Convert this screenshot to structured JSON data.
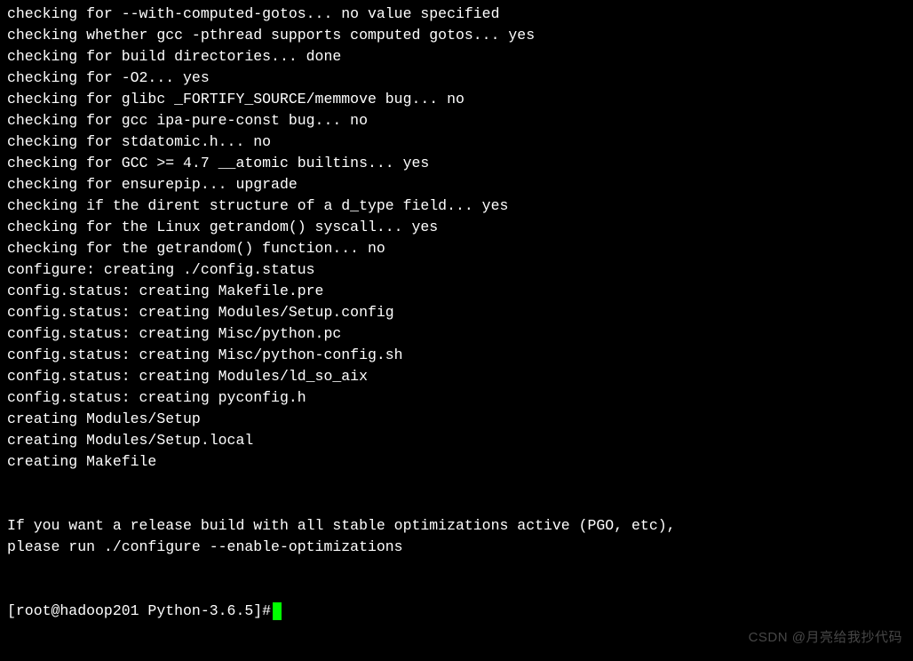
{
  "output_lines": [
    "checking for --with-computed-gotos... no value specified",
    "checking whether gcc -pthread supports computed gotos... yes",
    "checking for build directories... done",
    "checking for -O2... yes",
    "checking for glibc _FORTIFY_SOURCE/memmove bug... no",
    "checking for gcc ipa-pure-const bug... no",
    "checking for stdatomic.h... no",
    "checking for GCC >= 4.7 __atomic builtins... yes",
    "checking for ensurepip... upgrade",
    "checking if the dirent structure of a d_type field... yes",
    "checking for the Linux getrandom() syscall... yes",
    "checking for the getrandom() function... no",
    "configure: creating ./config.status",
    "config.status: creating Makefile.pre",
    "config.status: creating Modules/Setup.config",
    "config.status: creating Misc/python.pc",
    "config.status: creating Misc/python-config.sh",
    "config.status: creating Modules/ld_so_aix",
    "config.status: creating pyconfig.h",
    "creating Modules/Setup",
    "creating Modules/Setup.local",
    "creating Makefile",
    "",
    "",
    "If you want a release build with all stable optimizations active (PGO, etc),",
    "please run ./configure --enable-optimizations",
    "",
    ""
  ],
  "prompt": {
    "text": "[root@hadoop201 Python-3.6.5]# "
  },
  "watermark": "CSDN @月亮给我抄代码"
}
